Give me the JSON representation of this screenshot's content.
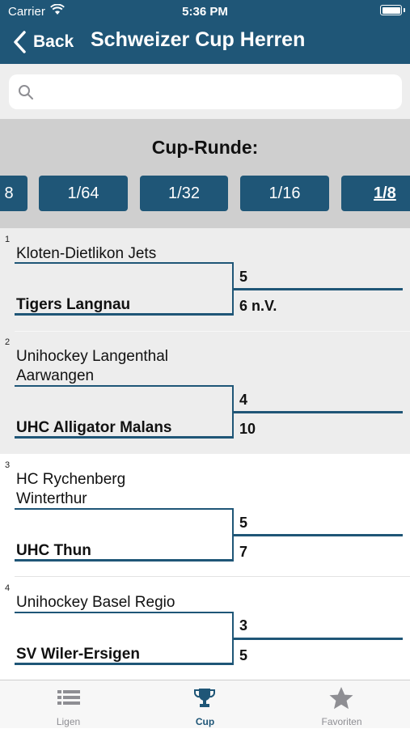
{
  "status": {
    "carrier": "Carrier",
    "time": "5:36 PM"
  },
  "nav": {
    "back_label": "Back",
    "title": "Schweizer Cup Herren"
  },
  "search": {
    "placeholder": ""
  },
  "rounds": {
    "heading": "Cup-Runde:",
    "buttons": [
      "8",
      "1/64",
      "1/32",
      "1/16",
      "1/8"
    ],
    "selected": "1/8"
  },
  "matches": [
    {
      "number": "1",
      "team_a": "Kloten-Dietlikon Jets",
      "team_b": "Tigers Langnau",
      "score_a": "5",
      "score_b": "6 n.V.",
      "winner": "b"
    },
    {
      "number": "2",
      "team_a": "Unihockey Langenthal Aarwangen",
      "team_b": "UHC Alligator Malans",
      "score_a": "4",
      "score_b": "10",
      "winner": "b"
    },
    {
      "number": "3",
      "team_a": "HC Rychenberg Winterthur",
      "team_b": "UHC Thun",
      "score_a": "5",
      "score_b": "7",
      "winner": "b"
    },
    {
      "number": "4",
      "team_a": "Unihockey Basel Regio",
      "team_b": "SV Wiler-Ersigen",
      "score_a": "3",
      "score_b": "5",
      "winner": "b"
    }
  ],
  "tabs": [
    {
      "label": "Ligen",
      "icon": "list-icon",
      "active": false
    },
    {
      "label": "Cup",
      "icon": "trophy-icon",
      "active": true
    },
    {
      "label": "Favoriten",
      "icon": "star-icon",
      "active": false
    }
  ],
  "colors": {
    "accent": "#1f5677",
    "inactive_tab": "#8e8e93"
  }
}
